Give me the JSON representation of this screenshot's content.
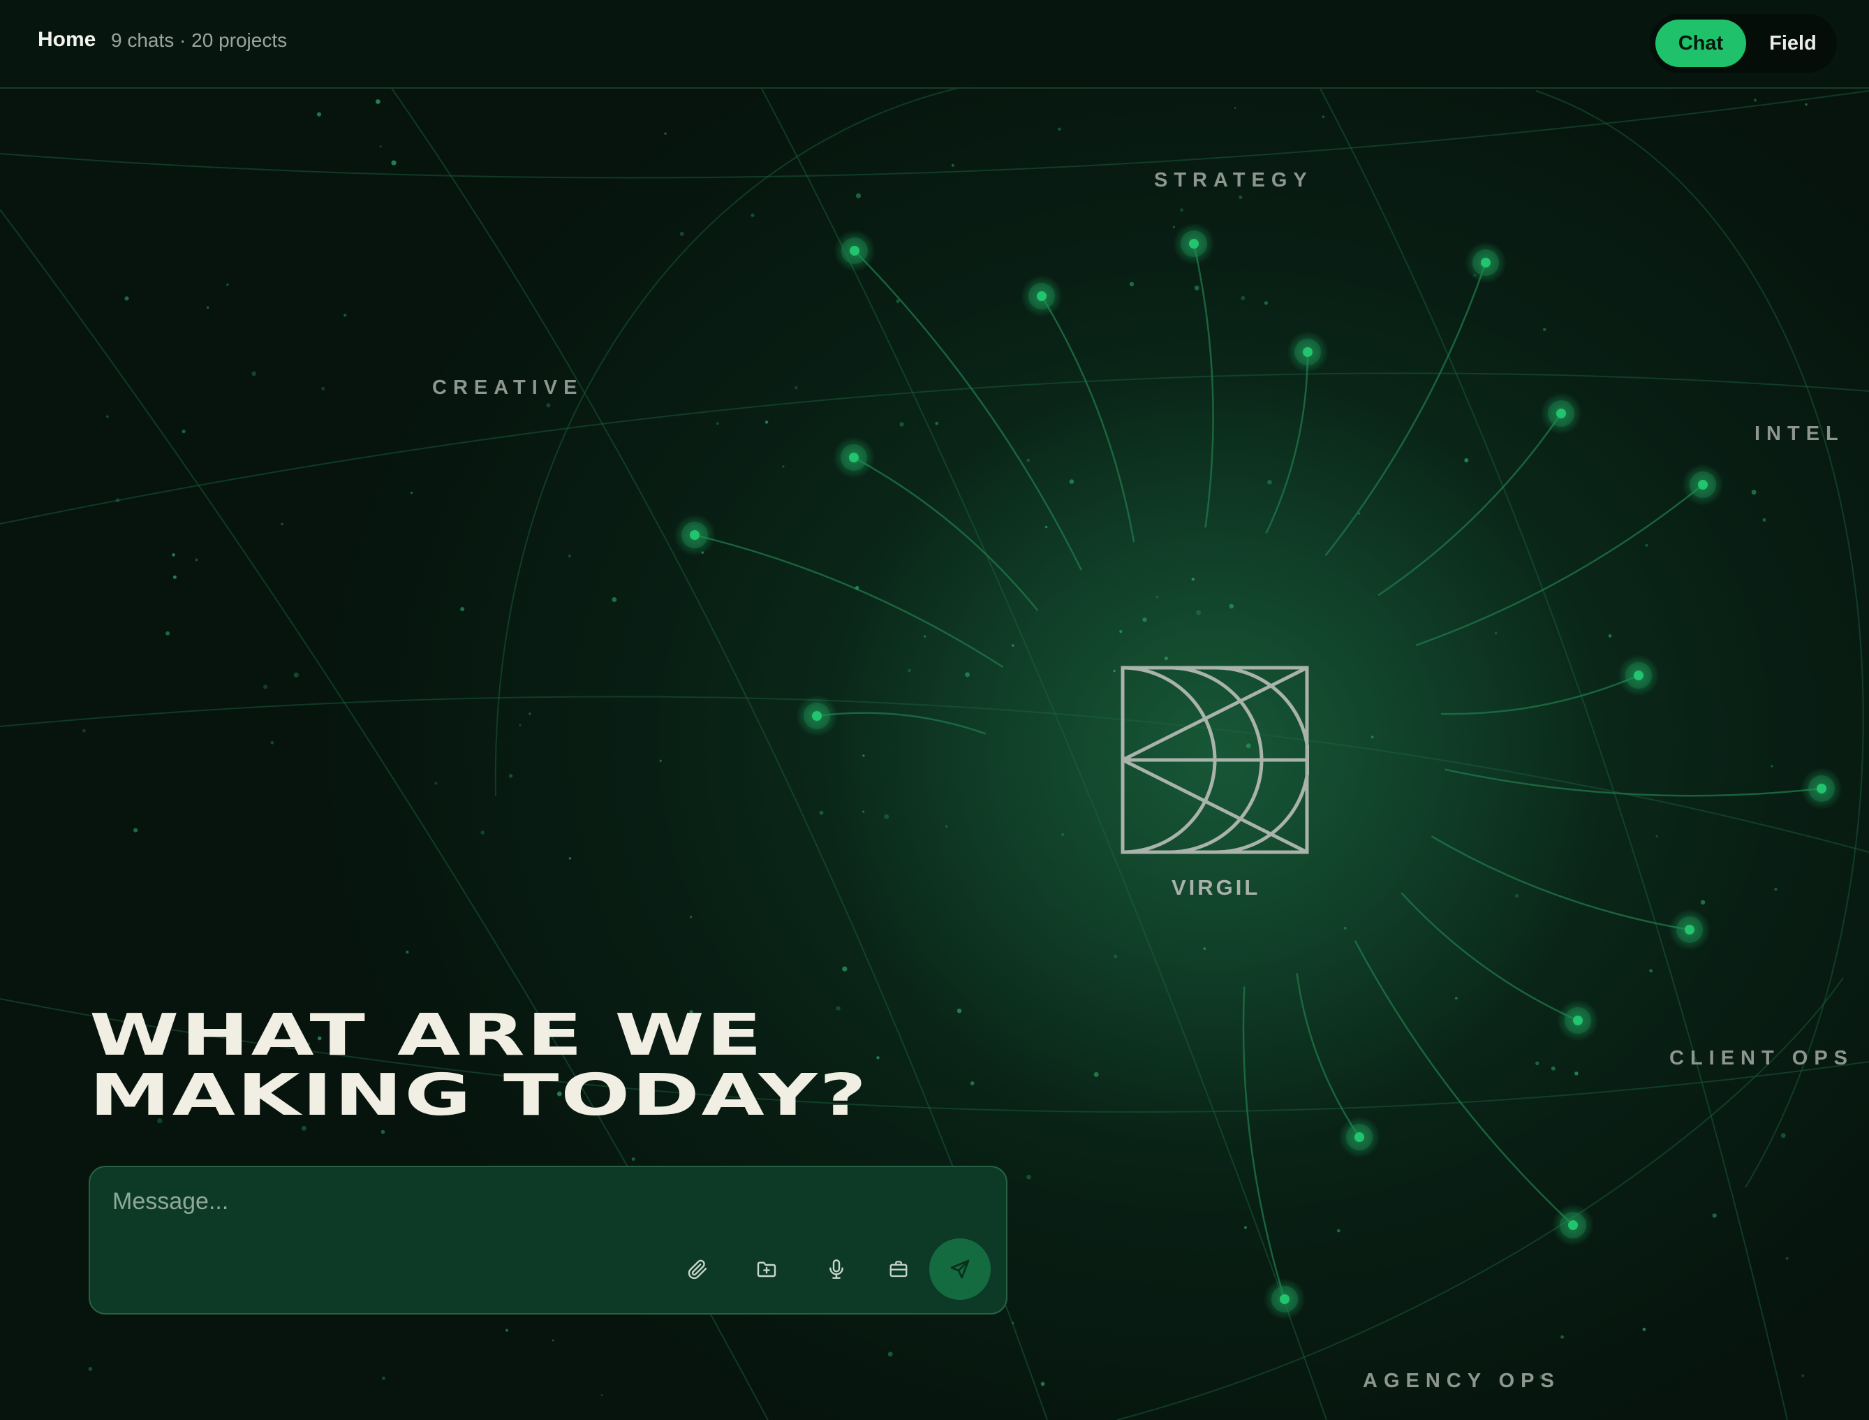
{
  "header": {
    "title": "Home",
    "meta": "9 chats · 20 projects",
    "mode_toggle": {
      "options": [
        "Chat",
        "Field"
      ],
      "selected": "Chat"
    }
  },
  "network": {
    "center": {
      "label": "VIRGIL",
      "icon": "virgil-logo-icon"
    },
    "categories": [
      "STRATEGY",
      "CREATIVE",
      "INTEL",
      "CLIENT OPS",
      "AGENCY OPS"
    ]
  },
  "hero": {
    "headline_line1": "What are we",
    "headline_line2": "making today?"
  },
  "composer": {
    "placeholder": "Message...",
    "tools": [
      "paperclip-icon",
      "folder-plus-icon",
      "microphone-icon",
      "briefcase-icon"
    ],
    "send_icon": "send-arrow-icon"
  },
  "colors": {
    "accent": "#1fc16b",
    "background": "#07170f",
    "node": "#22c46e",
    "headline": "#f1eee3"
  }
}
